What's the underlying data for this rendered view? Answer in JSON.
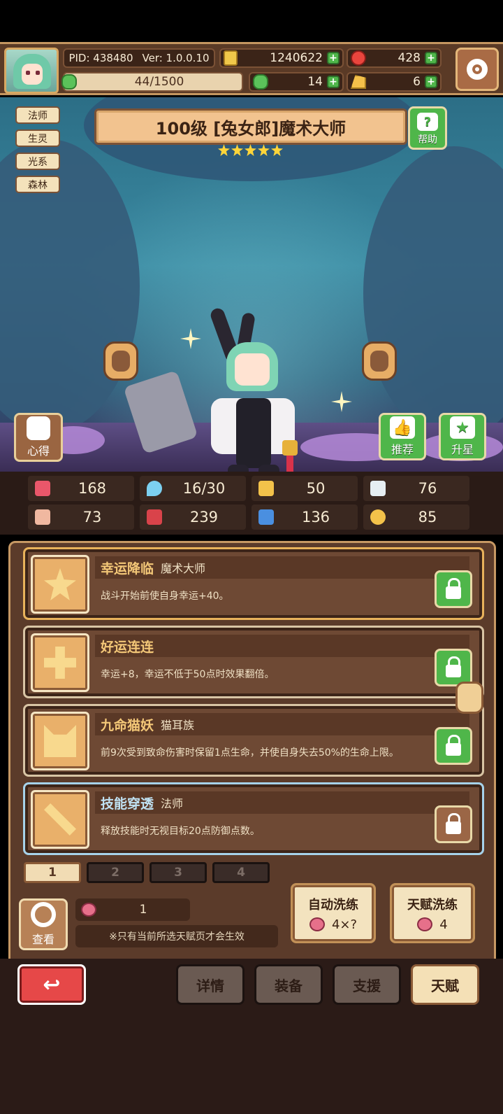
{
  "header": {
    "pid": "PID: 438480",
    "version": "Ver: 1.0.0.10",
    "gold": "1240622",
    "gems": "428",
    "exp": "44/1500",
    "clover": "14",
    "cheese": "6"
  },
  "tags": [
    "法师",
    "生灵",
    "光系",
    "森林"
  ],
  "hero": {
    "title": "100级 [兔女郎]魔术大师",
    "stars": 5,
    "help_label": "帮助"
  },
  "scene_buttons": {
    "notes": "心得",
    "recommend": "推荐",
    "star_up": "升星"
  },
  "stats": [
    "168",
    "16/30",
    "50",
    "76",
    "73",
    "239",
    "136",
    "85"
  ],
  "talents": [
    {
      "name": "幸运降临",
      "tag": "魔术大师",
      "desc": "战斗开始前使自身幸运+40。",
      "locked": true
    },
    {
      "name": "好运连连",
      "tag": "",
      "desc": "幸运+8，幸运不低于50点时效果翻倍。",
      "locked": true
    },
    {
      "name": "九命猫妖",
      "tag": "猫耳族",
      "desc": "前9次受到致命伤害时保留1点生命，并使自身失去50%的生命上限。",
      "locked": true
    },
    {
      "name": "技能穿透",
      "tag": "法师",
      "desc": "释放技能时无视目标20点防御点数。",
      "locked": false
    }
  ],
  "pages": [
    "1",
    "2",
    "3",
    "4"
  ],
  "bottom_panel": {
    "view_label": "查看",
    "peach_count": "1",
    "note": "※只有当前所选天赋页才会生效",
    "auto_wash": {
      "title": "自动洗练",
      "cost": "4×?"
    },
    "talent_wash": {
      "title": "天赋洗练",
      "cost": "4"
    }
  },
  "nav": [
    "详情",
    "装备",
    "支援",
    "天赋"
  ],
  "colors": {
    "accent": "#c69863",
    "green": "#4fb64a",
    "red": "#e64848"
  }
}
